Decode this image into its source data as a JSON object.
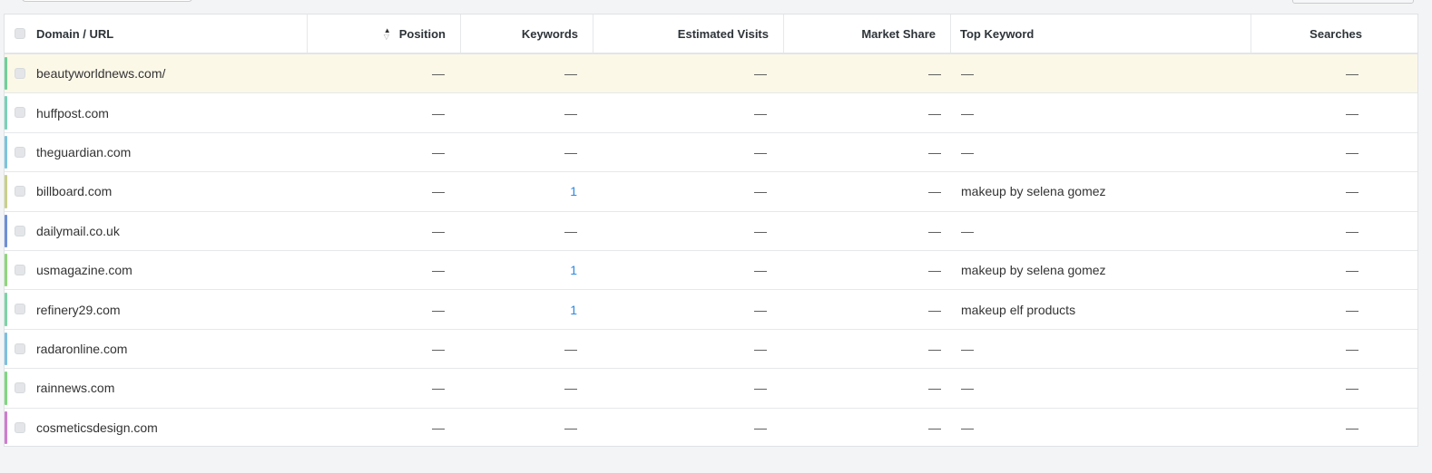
{
  "colors": {
    "accent": "#2d8ae0",
    "highlight_row": "#fcf8e8"
  },
  "table": {
    "headers": {
      "domain": "Domain / URL",
      "position": "Position",
      "keywords": "Keywords",
      "visits": "Estimated Visits",
      "share": "Market Share",
      "top_keyword": "Top Keyword",
      "searches": "Searches"
    },
    "rows": [
      {
        "domain": "beautyworldnews.com/",
        "position": "—",
        "keywords": "—",
        "visits": "—",
        "share": "—",
        "top_keyword": "—",
        "searches": "—",
        "color": "#6fcf97"
      },
      {
        "domain": "huffpost.com",
        "position": "—",
        "keywords": "—",
        "visits": "—",
        "share": "—",
        "top_keyword": "—",
        "searches": "—",
        "color": "#79d1b7"
      },
      {
        "domain": "theguardian.com",
        "position": "—",
        "keywords": "—",
        "visits": "—",
        "share": "—",
        "top_keyword": "—",
        "searches": "—",
        "color": "#7cc4dc"
      },
      {
        "domain": "billboard.com",
        "position": "—",
        "keywords": "1",
        "visits": "—",
        "share": "—",
        "top_keyword": "makeup by selena gomez",
        "searches": "—",
        "color": "#c9d08a"
      },
      {
        "domain": "dailymail.co.uk",
        "position": "—",
        "keywords": "—",
        "visits": "—",
        "share": "—",
        "top_keyword": "—",
        "searches": "—",
        "color": "#6d8fd6"
      },
      {
        "domain": "usmagazine.com",
        "position": "—",
        "keywords": "1",
        "visits": "—",
        "share": "—",
        "top_keyword": "makeup by selena gomez",
        "searches": "—",
        "color": "#8fd67a"
      },
      {
        "domain": "refinery29.com",
        "position": "—",
        "keywords": "1",
        "visits": "—",
        "share": "—",
        "top_keyword": "makeup elf products",
        "searches": "—",
        "color": "#7dd3a5"
      },
      {
        "domain": "radaronline.com",
        "position": "—",
        "keywords": "—",
        "visits": "—",
        "share": "—",
        "top_keyword": "—",
        "searches": "—",
        "color": "#7cbfe0"
      },
      {
        "domain": "rainnews.com",
        "position": "—",
        "keywords": "—",
        "visits": "—",
        "share": "—",
        "top_keyword": "—",
        "searches": "—",
        "color": "#7fd67f"
      },
      {
        "domain": "cosmeticsdesign.com",
        "position": "—",
        "keywords": "—",
        "visits": "—",
        "share": "—",
        "top_keyword": "—",
        "searches": "—",
        "color": "#d07ccf"
      }
    ]
  }
}
